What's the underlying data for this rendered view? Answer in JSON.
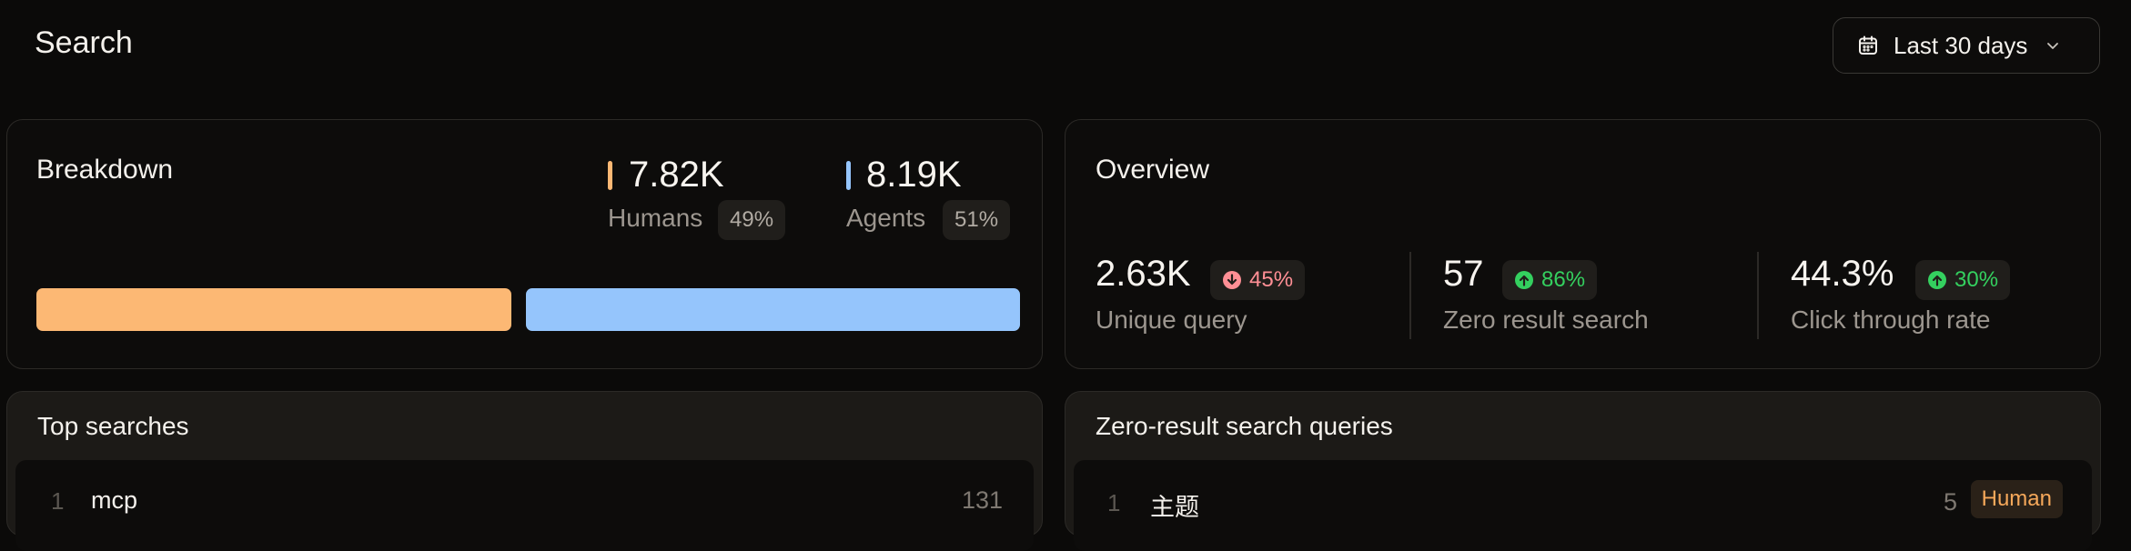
{
  "header": {
    "title": "Search",
    "date_range": "Last 30 days"
  },
  "breakdown": {
    "title": "Breakdown",
    "humans": {
      "value": "7.82K",
      "label": "Humans",
      "pct": "49%",
      "share": 49,
      "color": "#fcb874"
    },
    "agents": {
      "value": "8.19K",
      "label": "Agents",
      "pct": "51%",
      "share": 51,
      "color": "#95c5fc"
    }
  },
  "overview": {
    "title": "Overview",
    "metrics": [
      {
        "value": "2.63K",
        "label": "Unique query",
        "change": "45%",
        "direction": "down"
      },
      {
        "value": "57",
        "label": "Zero result search",
        "change": "86%",
        "direction": "up"
      },
      {
        "value": "44.3%",
        "label": "Click through rate",
        "change": "30%",
        "direction": "up"
      }
    ]
  },
  "top_searches": {
    "title": "Top searches",
    "rows": [
      {
        "rank": "1",
        "query": "mcp",
        "count": "131"
      }
    ]
  },
  "zero_result": {
    "title": "Zero-result search queries",
    "rows": [
      {
        "rank": "1",
        "query": "主题",
        "count": "5",
        "tag": "Human"
      }
    ]
  },
  "colors": {
    "up": "#34d05f",
    "down": "#ff8f95",
    "background": "#0b0a09"
  }
}
